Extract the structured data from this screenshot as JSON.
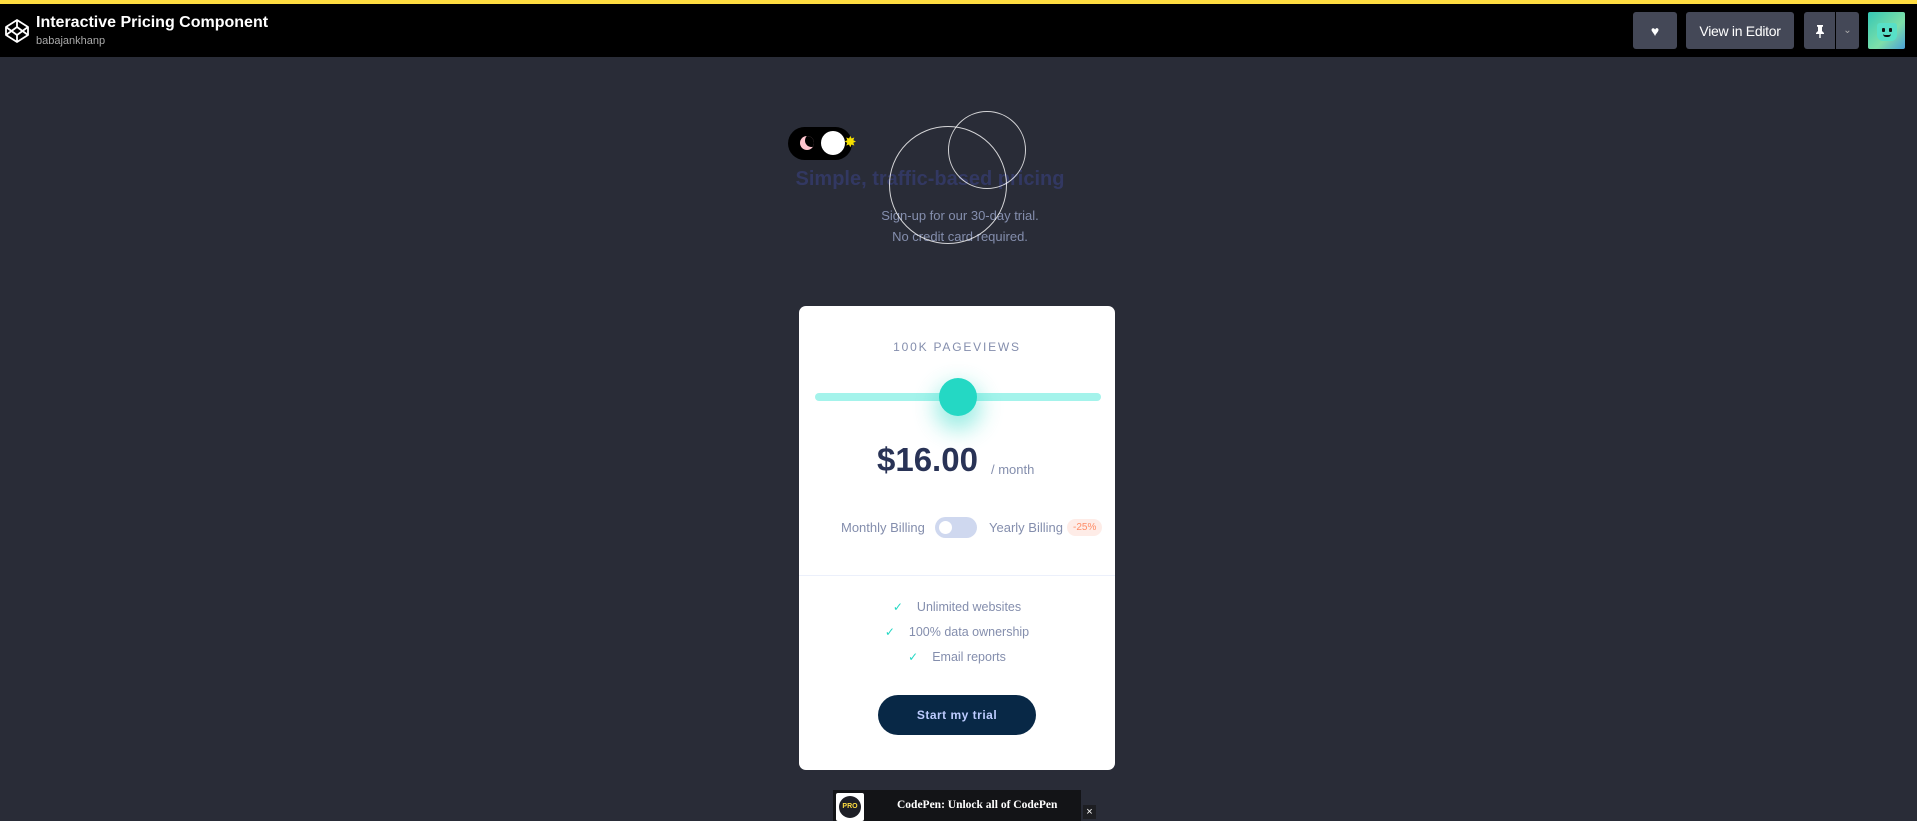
{
  "header": {
    "title": "Interactive Pricing Component",
    "author": "babajankhanp",
    "heart_icon": "♥",
    "view_editor_label": "View in Editor",
    "pin_icon": "📌",
    "caret_icon": "⌄"
  },
  "hero": {
    "headline": "Simple, traffic-based pricing",
    "subtitle_line1": "Sign-up for our 30-day trial.",
    "subtitle_line2": "No credit card required."
  },
  "card": {
    "pageviews": "100K PAGEVIEWS",
    "slider_level_pct": 50,
    "price": "$16.00",
    "period": "/ month",
    "monthly_label": "Monthly Billing",
    "yearly_label": "Yearly Billing",
    "discount": "-25%",
    "yearly_enabled": false,
    "features": [
      {
        "check": "✓",
        "label": "Unlimited websites"
      },
      {
        "check": "✓",
        "label": "100% data ownership"
      },
      {
        "check": "✓",
        "label": "Email reports"
      }
    ],
    "cta_label": "Start my trial"
  },
  "pro_banner": {
    "badge": "PRO",
    "text": "CodePen: Unlock all of CodePen",
    "close_icon": "×"
  },
  "colors": {
    "background": "#292c37",
    "accent": "#24d8c4",
    "slider_track": "#a4f3eb",
    "cta": "#082846",
    "top_line": "#ffdd40"
  }
}
